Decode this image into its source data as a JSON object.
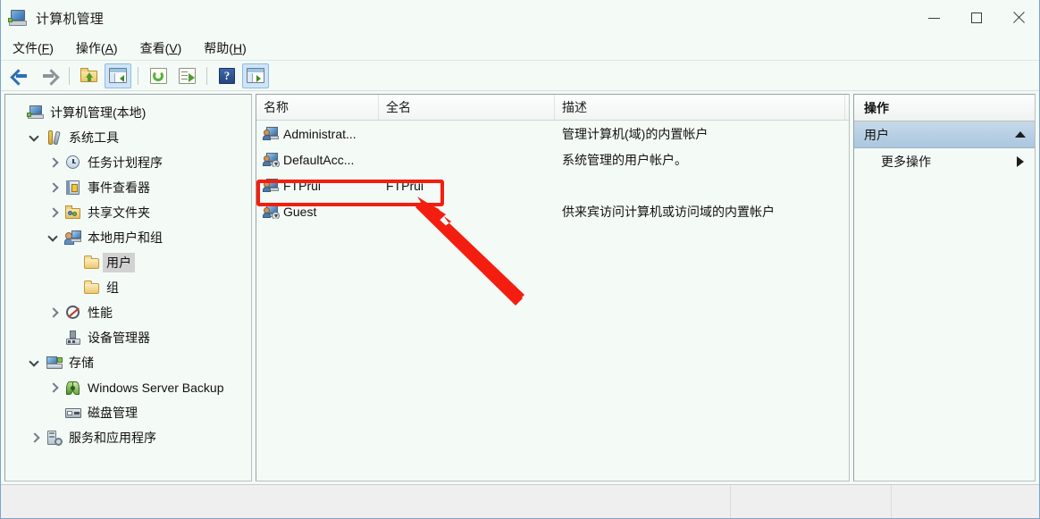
{
  "window": {
    "title": "计算机管理",
    "icon": "computer-icon",
    "controls": {
      "minimize": "–",
      "maximize": "□",
      "close": "✕"
    }
  },
  "menubar": {
    "items": [
      {
        "label": "文件",
        "accel": "F",
        "name": "menu-file"
      },
      {
        "label": "操作",
        "accel": "A",
        "name": "menu-action"
      },
      {
        "label": "查看",
        "accel": "V",
        "name": "menu-view"
      },
      {
        "label": "帮助",
        "accel": "H",
        "name": "menu-help"
      }
    ]
  },
  "toolbar": {
    "buttons": [
      {
        "name": "back-icon",
        "pressed": false
      },
      {
        "name": "forward-icon",
        "pressed": false
      },
      {
        "name": "up-folder-icon",
        "pressed": false
      },
      {
        "name": "show-tree-icon",
        "pressed": true
      },
      {
        "name": "refresh-icon",
        "pressed": false
      },
      {
        "name": "export-list-icon",
        "pressed": false
      },
      {
        "name": "help-icon",
        "pressed": false
      },
      {
        "name": "show-action-pane-icon",
        "pressed": true
      }
    ],
    "help_glyph": "?"
  },
  "tree": {
    "nodes": [
      {
        "label": "计算机管理(本地)",
        "depth": 0,
        "twisty": "none",
        "icon": "computer-icon",
        "selected": false
      },
      {
        "label": "系统工具",
        "depth": 1,
        "twisty": "down",
        "icon": "tools-icon",
        "selected": false
      },
      {
        "label": "任务计划程序",
        "depth": 2,
        "twisty": "right",
        "icon": "clock-icon",
        "selected": false
      },
      {
        "label": "事件查看器",
        "depth": 2,
        "twisty": "right",
        "icon": "event-icon",
        "selected": false
      },
      {
        "label": "共享文件夹",
        "depth": 2,
        "twisty": "right",
        "icon": "share-folder-icon",
        "selected": false
      },
      {
        "label": "本地用户和组",
        "depth": 2,
        "twisty": "down",
        "icon": "users-icon",
        "selected": false
      },
      {
        "label": "用户",
        "depth": 3,
        "twisty": "none",
        "icon": "folder-icon",
        "selected": true
      },
      {
        "label": "组",
        "depth": 3,
        "twisty": "none",
        "icon": "folder-icon",
        "selected": false
      },
      {
        "label": "性能",
        "depth": 2,
        "twisty": "right",
        "icon": "performance-icon",
        "selected": false
      },
      {
        "label": "设备管理器",
        "depth": 2,
        "twisty": "none",
        "icon": "device-manager-icon",
        "selected": false
      },
      {
        "label": "存储",
        "depth": 1,
        "twisty": "down",
        "icon": "storage-icon",
        "selected": false
      },
      {
        "label": "Windows Server Backup",
        "depth": 2,
        "twisty": "right",
        "icon": "backup-icon",
        "selected": false
      },
      {
        "label": "磁盘管理",
        "depth": 2,
        "twisty": "none",
        "icon": "disk-icon",
        "selected": false
      },
      {
        "label": "服务和应用程序",
        "depth": 1,
        "twisty": "right",
        "icon": "services-icon",
        "selected": false
      }
    ]
  },
  "list": {
    "columns": [
      {
        "label": "名称",
        "name": "column-name"
      },
      {
        "label": "全名",
        "name": "column-fullname"
      },
      {
        "label": "描述",
        "name": "column-description"
      }
    ],
    "rows": [
      {
        "name": "Administrat...",
        "fullname": "",
        "description": "管理计算机(域)的内置帐户",
        "icon": "user-icon",
        "disabled": false,
        "highlighted": false
      },
      {
        "name": "DefaultAcc...",
        "fullname": "",
        "description": "系统管理的用户帐户。",
        "icon": "user-icon",
        "disabled": true,
        "highlighted": false
      },
      {
        "name": "FTPrui",
        "fullname": "FTPrui",
        "description": "",
        "icon": "user-icon",
        "disabled": false,
        "highlighted": true
      },
      {
        "name": "Guest",
        "fullname": "",
        "description": "供来宾访问计算机或访问域的内置帐户",
        "icon": "user-icon",
        "disabled": true,
        "highlighted": false
      }
    ]
  },
  "action_pane": {
    "header": "操作",
    "section": {
      "label": "用户",
      "collapse_icon": "triangle-up-icon"
    },
    "items": [
      {
        "label": "更多操作",
        "submenu_icon": "triangle-right-icon"
      }
    ]
  },
  "annotations": {
    "highlight_color": "#f41e10",
    "box_target": "FTPrui",
    "arrow": "red-arrow-pointing-to-ftprui-row"
  },
  "colors": {
    "window_bg": "#f4faf6",
    "accent_blue": "#abc6de",
    "selection_gray": "#d2d2d2",
    "annotation_red": "#f41e10"
  }
}
